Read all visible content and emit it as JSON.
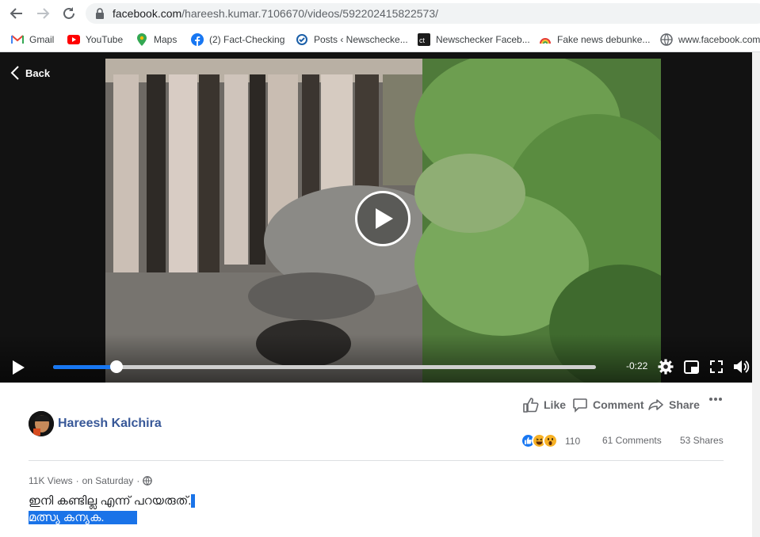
{
  "browser": {
    "url_host": "facebook.com",
    "url_path": "/hareesh.kumar.7106670/videos/592202415822573/",
    "bookmarks": [
      {
        "label": "Gmail",
        "icon": "gmail-icon"
      },
      {
        "label": "YouTube",
        "icon": "youtube-icon"
      },
      {
        "label": "Maps",
        "icon": "maps-icon"
      },
      {
        "label": "(2) Fact-Checking",
        "icon": "facebook-icon"
      },
      {
        "label": "Posts ‹ Newschecke...",
        "icon": "newschecker-icon"
      },
      {
        "label": "Newschecker Faceb...",
        "icon": "ct-icon"
      },
      {
        "label": "Fake news debunke...",
        "icon": "rainbow-icon"
      },
      {
        "label": "www.facebook.com",
        "icon": "globe-icon"
      }
    ]
  },
  "player": {
    "back_label": "Back",
    "time_remaining": "-0:22",
    "progress_fraction": 0.117
  },
  "post": {
    "author": "Hareesh Kalchira",
    "actions": {
      "like": "Like",
      "comment": "Comment",
      "share": "Share"
    },
    "reaction_count": "110",
    "comments": "61 Comments",
    "shares": "53 Shares",
    "views": "11K Views",
    "date": "on Saturday",
    "caption_line1": "ഇനി കണ്ടില്ല എന്ന് പറയരുത്.",
    "caption_line2": "മത്സ്യ കന്യക."
  },
  "colors": {
    "accent": "#1877f2",
    "author": "#385898",
    "selection": "#1a73e8"
  }
}
